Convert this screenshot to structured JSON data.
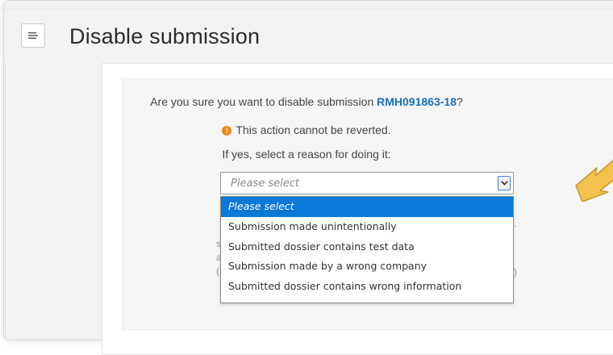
{
  "header": {
    "title": "Disable submission",
    "menu_icon": "hamburger-menu-icon"
  },
  "dialog": {
    "question_prefix": "Are you sure you want to disable submission ",
    "submission_id": "RMH091863-18",
    "question_suffix": "?",
    "warning_icon": "warning-circle-icon",
    "warning_text": "This action cannot be reverted.",
    "reason_prompt": "If yes, select a reason for doing it:",
    "reason_select": {
      "selected_value": "Please select",
      "options": [
        "Please select",
        "Submission made unintentionally",
        "Submitted dossier contains test data",
        "Submission made by a wrong company",
        "Submitted dossier contains wrong information"
      ]
    }
  },
  "colors": {
    "link_blue": "#1a6fb5",
    "selected_option_bg": "#0a78d7",
    "warning_orange": "#f0891a",
    "pointer_arrow": "#f2c14e"
  }
}
